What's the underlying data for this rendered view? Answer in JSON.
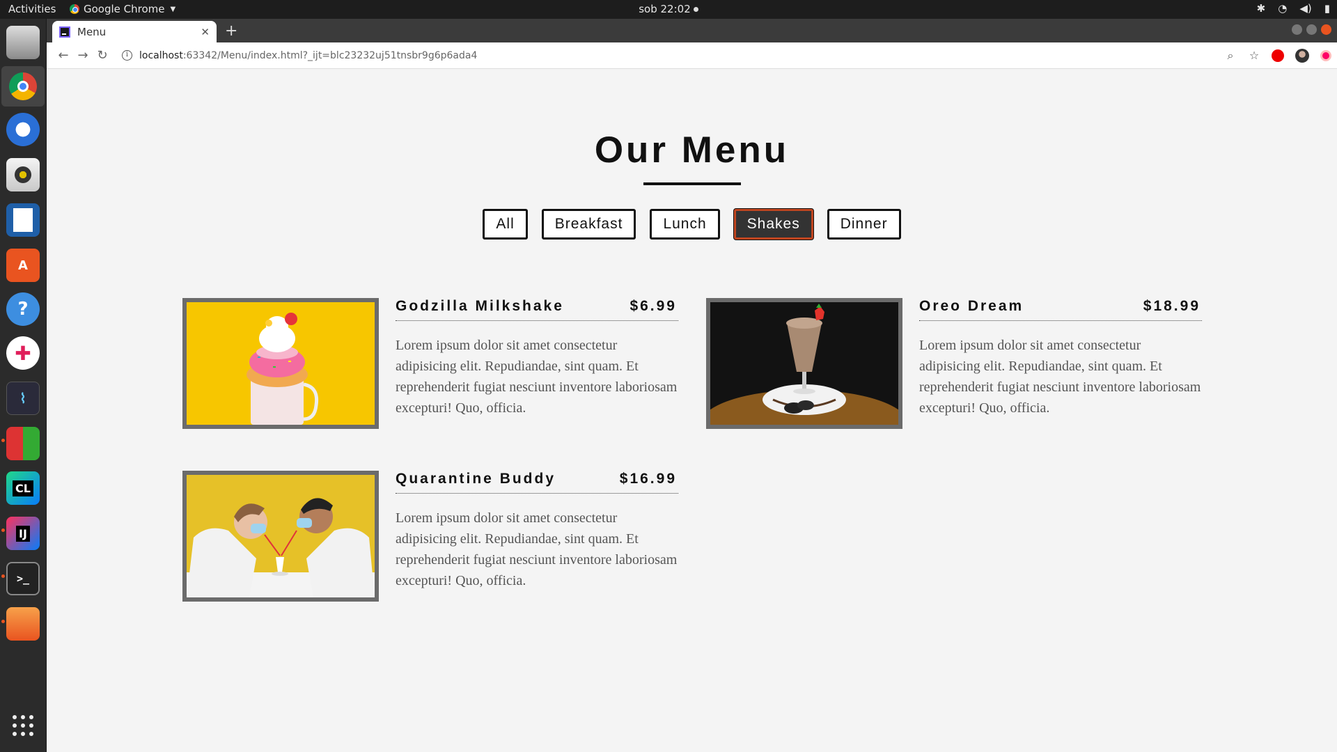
{
  "topbar": {
    "activities": "Activities",
    "app_name": "Google Chrome",
    "clock": "sob 22:02"
  },
  "browser": {
    "tab_title": "Menu",
    "url_host": "localhost",
    "url_rest": ":63342/Menu/index.html?_ijt=blc23232uj51tnsbr9g6p6ada4"
  },
  "page": {
    "title": "Our Menu",
    "filters": [
      "All",
      "Breakfast",
      "Lunch",
      "Shakes",
      "Dinner"
    ],
    "active_filter": "Shakes",
    "items": [
      {
        "name": "Godzilla Milkshake",
        "price": "$6.99",
        "description": "Lorem ipsum dolor sit amet consectetur adipisicing elit. Repudiandae, sint quam. Et reprehenderit fugiat nesciunt inventore laboriosam excepturi! Quo, officia."
      },
      {
        "name": "Oreo Dream",
        "price": "$18.99",
        "description": "Lorem ipsum dolor sit amet consectetur adipisicing elit. Repudiandae, sint quam. Et reprehenderit fugiat nesciunt inventore laboriosam excepturi! Quo, officia."
      },
      {
        "name": "Quarantine Buddy",
        "price": "$16.99",
        "description": "Lorem ipsum dolor sit amet consectetur adipisicing elit. Repudiandae, sint quam. Et reprehenderit fugiat nesciunt inventore laboriosam excepturi! Quo, officia."
      }
    ]
  },
  "colors": {
    "page_bg": "#f4f4f4",
    "active_filter_bg": "#333333",
    "active_filter_border": "#c0451f",
    "photo_frame": "#6b6b6b",
    "ubuntu_orange": "#e95420"
  },
  "icons": {
    "dock": [
      "files-icon",
      "chrome-icon",
      "thunderbird-icon",
      "rhythmbox-icon",
      "writer-icon",
      "software-center-icon",
      "help-icon",
      "slack-icon",
      "system-monitor-icon",
      "cube-game-icon",
      "clion-icon",
      "intellij-icon",
      "terminal-icon",
      "folder-icon",
      "show-apps-icon"
    ]
  }
}
